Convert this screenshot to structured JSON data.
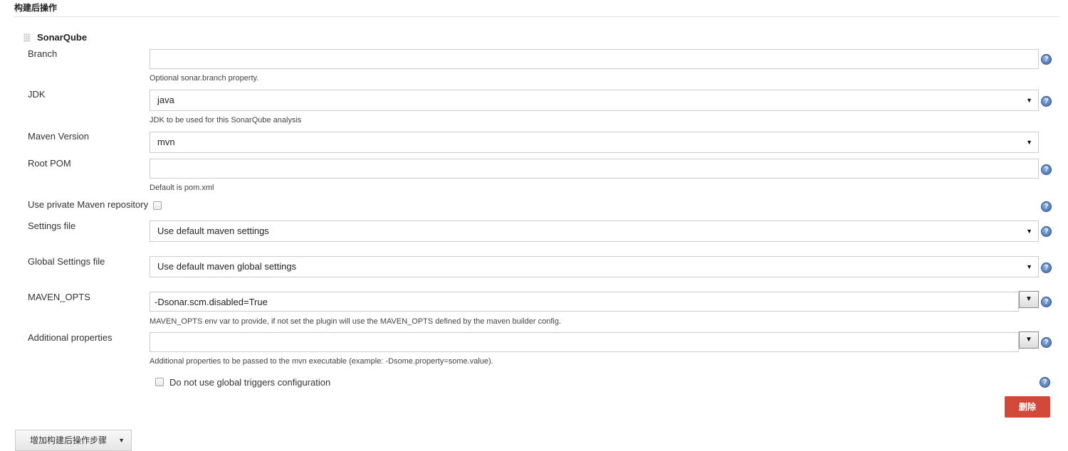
{
  "section": {
    "title": "构建后操作"
  },
  "plugin": {
    "name": "SonarQube"
  },
  "fields": {
    "branch": {
      "label": "Branch",
      "value": "",
      "description": "Optional sonar.branch property."
    },
    "jdk": {
      "label": "JDK",
      "value": "java",
      "description": "JDK to be used for this SonarQube analysis"
    },
    "maven_version": {
      "label": "Maven Version",
      "value": "mvn"
    },
    "root_pom": {
      "label": "Root POM",
      "value": "",
      "description": "Default is pom.xml"
    },
    "private_repo": {
      "label": "Use private Maven repository",
      "checked": false
    },
    "settings_file": {
      "label": "Settings file",
      "value": "Use default maven settings"
    },
    "global_settings_file": {
      "label": "Global Settings file",
      "value": "Use default maven global settings"
    },
    "maven_opts": {
      "label": "MAVEN_OPTS",
      "value": "-Dsonar.scm.disabled=True",
      "description": "MAVEN_OPTS env var to provide, if not set the plugin will use the MAVEN_OPTS defined by the maven builder config."
    },
    "additional_properties": {
      "label": "Additional properties",
      "value": "",
      "description": "Additional properties to be passed to the mvn executable (example: -Dsome.property=some.value)."
    },
    "global_triggers": {
      "label": "Do not use global triggers configuration",
      "checked": false
    }
  },
  "icons": {
    "help": "help-icon",
    "select_arrow": "▼",
    "expand": "▼"
  },
  "buttons": {
    "delete": "删除",
    "add_step": "增加构建后操作步骤"
  },
  "colors": {
    "delete_button": "#d24939",
    "help_icon": "#3c68a8"
  }
}
